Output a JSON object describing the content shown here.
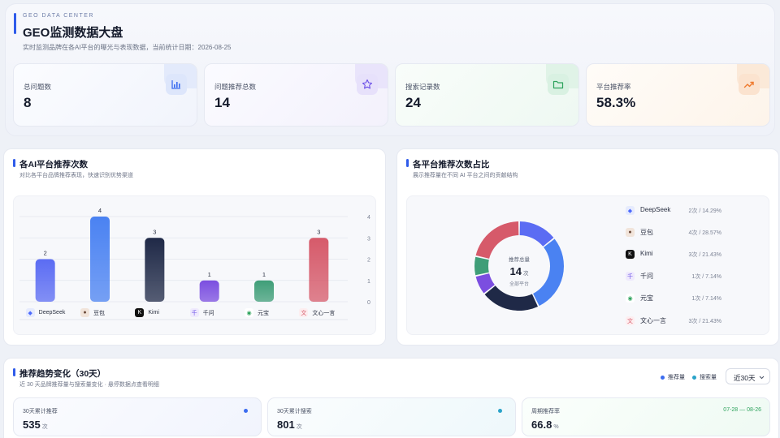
{
  "header": {
    "eyebrow": "GEO DATA CENTER",
    "title": "GEO监测数据大盘",
    "subtitle": "实时监测品牌在各AI平台的曝光与表现数据，当前统计日期：2026-08-25"
  },
  "stats": [
    {
      "label": "总问题数",
      "value": "8",
      "icon": "bar-chart-icon",
      "color": "#3b6cf0"
    },
    {
      "label": "问题推荐总数",
      "value": "14",
      "icon": "star-icon",
      "color": "#6a4ee8"
    },
    {
      "label": "搜索记录数",
      "value": "24",
      "icon": "folder-icon",
      "color": "#2ea35d"
    },
    {
      "label": "平台推荐率",
      "value": "58.3%",
      "icon": "trend-up-icon",
      "color": "#ef7a2e"
    }
  ],
  "bar_panel": {
    "title": "各AI平台推荐次数",
    "subtitle": "对比各平台品牌推荐表现，快速识别优势渠道"
  },
  "donut_panel": {
    "title": "各平台推荐次数占比",
    "subtitle": "展示推荐量在不同 AI 平台之间的贡献结构",
    "center_label": "推荐总量",
    "center_value": "14",
    "center_unit": "次",
    "center_sub": "全部平台"
  },
  "chart_data": [
    {
      "type": "bar",
      "categories": [
        "DeepSeek",
        "豆包",
        "Kimi",
        "千问",
        "元宝",
        "文心一言"
      ],
      "values": [
        2,
        4,
        3,
        1,
        1,
        3
      ],
      "y_ticks": [
        "0",
        "1",
        "2",
        "3",
        "4"
      ],
      "ylim": [
        0,
        4
      ],
      "colors": [
        "#5b6cf3",
        "#4a82f2",
        "#1f2947",
        "#7b4ee0",
        "#3f9e78",
        "#d65a6a"
      ],
      "icons": [
        "deepseek-icon",
        "doubao-icon",
        "kimi-icon",
        "qianwen-icon",
        "yuanbao-icon",
        "wenxin-icon"
      ],
      "grid": true
    },
    {
      "type": "pie",
      "categories": [
        "DeepSeek",
        "豆包",
        "Kimi",
        "千问",
        "元宝",
        "文心一言"
      ],
      "values": [
        2,
        4,
        3,
        1,
        1,
        3
      ],
      "value_labels": [
        "2次 / 14.29%",
        "4次 / 28.57%",
        "3次 / 21.43%",
        "1次 / 7.14%",
        "1次 / 7.14%",
        "3次 / 21.43%"
      ],
      "colors": [
        "#5b6cf3",
        "#4a82f2",
        "#1f2947",
        "#7b4ee0",
        "#3f9e78",
        "#d65a6a"
      ],
      "legend": "right"
    }
  ],
  "trend": {
    "title": "推荐趋势变化（30天）",
    "subtitle": "近 30 天品牌推荐量与搜索量变化 · 悬停数据点查看明细",
    "legend": [
      {
        "label": "推荐量",
        "color": "#3b6cf0"
      },
      {
        "label": "搜索量",
        "color": "#2aa3c9"
      }
    ],
    "range_select": "近30天",
    "cards": [
      {
        "label": "30天累计推荐",
        "value": "535",
        "unit": "次",
        "dot": "#3b6cf0"
      },
      {
        "label": "30天累计搜索",
        "value": "801",
        "unit": "次",
        "dot": "#2aa3c9"
      },
      {
        "label": "周期推荐率",
        "value": "66.8",
        "unit": "%",
        "date_range": "07-28 — 08-26"
      }
    ]
  }
}
